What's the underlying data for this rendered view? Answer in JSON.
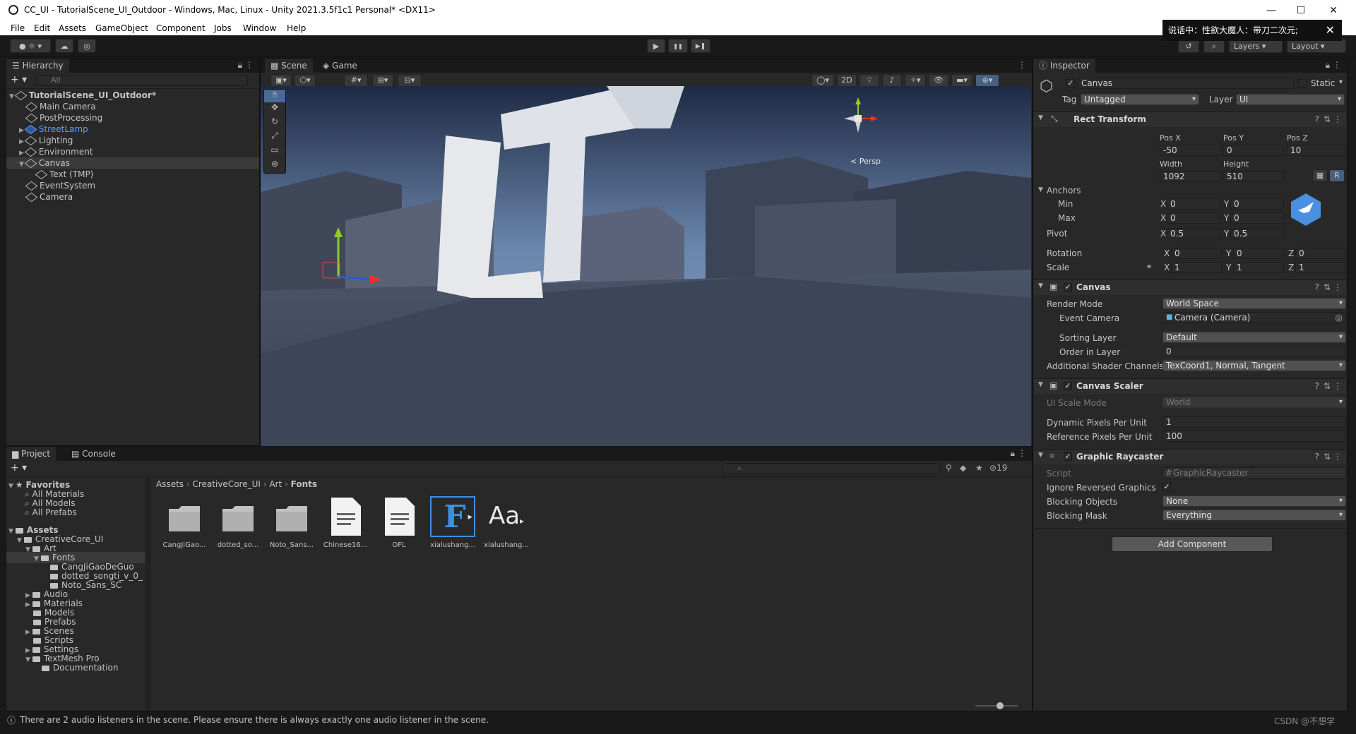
{
  "window": {
    "title": "CC_UI - TutorialScene_UI_Outdoor - Windows, Mac, Linux - Unity 2021.3.5f1c1 Personal* <DX11>",
    "minimize": "—",
    "maximize": "☐",
    "close": "✕"
  },
  "menu": [
    "File",
    "Edit",
    "Assets",
    "GameObject",
    "Component",
    "Jobs",
    "Window",
    "Help"
  ],
  "toolbar": {
    "play": "▶",
    "pause": "❚❚",
    "step": "▶❚",
    "layers": "Layers",
    "layout": "Layout",
    "notification": "说话中：性欲大魔人：带刀二次元;"
  },
  "hierarchy": {
    "tab": "Hierarchy",
    "search_placeholder": "All",
    "items": [
      {
        "label": "TutorialScene_UI_Outdoor*",
        "depth": 0
      },
      {
        "label": "Main Camera",
        "depth": 1
      },
      {
        "label": "PostProcessing",
        "depth": 1
      },
      {
        "label": "StreetLamp",
        "depth": 1
      },
      {
        "label": "Lighting",
        "depth": 1
      },
      {
        "label": "Environment",
        "depth": 1
      },
      {
        "label": "Canvas",
        "depth": 1
      },
      {
        "label": "Text (TMP)",
        "depth": 2
      },
      {
        "label": "EventSystem",
        "depth": 1
      },
      {
        "label": "Camera",
        "depth": 1
      }
    ]
  },
  "scene": {
    "tabs": [
      "Scene",
      "Game"
    ],
    "mode_2d": "2D",
    "persp": "< Persp"
  },
  "project": {
    "tabs": [
      "Project",
      "Console"
    ],
    "favorites_label": "Favorites",
    "favorites": [
      "All Materials",
      "All Models",
      "All Prefabs"
    ],
    "assets_label": "Assets",
    "tree": [
      {
        "label": "CreativeCore_UI",
        "depth": 1
      },
      {
        "label": "Art",
        "depth": 2
      },
      {
        "label": "Fonts",
        "depth": 3
      },
      {
        "label": "CangJiGaoDeGuo",
        "depth": 4
      },
      {
        "label": "dotted_songti_v_0_",
        "depth": 4
      },
      {
        "label": "Noto_Sans_SC",
        "depth": 4
      },
      {
        "label": "Audio",
        "depth": 2
      },
      {
        "label": "Materials",
        "depth": 2
      },
      {
        "label": "Models",
        "depth": 2
      },
      {
        "label": "Prefabs",
        "depth": 2
      },
      {
        "label": "Scenes",
        "depth": 2
      },
      {
        "label": "Scripts",
        "depth": 2
      },
      {
        "label": "Settings",
        "depth": 2
      },
      {
        "label": "TextMesh Pro",
        "depth": 2
      },
      {
        "label": "Documentation",
        "depth": 3
      }
    ],
    "breadcrumb": [
      "Assets",
      "CreativeCore_UI",
      "Art",
      "Fonts"
    ],
    "hidden_count": "19",
    "assets": [
      {
        "label": "CangJiGao...",
        "kind": "folder"
      },
      {
        "label": "dotted_so...",
        "kind": "folder"
      },
      {
        "label": "Noto_Sans...",
        "kind": "folder"
      },
      {
        "label": "Chinese16...",
        "kind": "doc"
      },
      {
        "label": "OFL",
        "kind": "doc"
      },
      {
        "label": "xialushang...",
        "kind": "font-asset"
      },
      {
        "label": "xialushang...",
        "kind": "font"
      }
    ]
  },
  "inspector": {
    "tab": "Inspector",
    "object_name": "Canvas",
    "static_label": "Static",
    "tag_label": "Tag",
    "tag_value": "Untagged",
    "layer_label": "Layer",
    "layer_value": "UI",
    "rect": {
      "title": "Rect Transform",
      "posx_label": "Pos X",
      "posy_label": "Pos Y",
      "posz_label": "Pos Z",
      "posx": "-50",
      "posy": "0",
      "posz": "10",
      "width_label": "Width",
      "height_label": "Height",
      "width": "1092",
      "height": "510",
      "r_button": "R",
      "anchors_label": "Anchors",
      "min_label": "Min",
      "max_label": "Max",
      "min_x": "0",
      "min_y": "0",
      "max_x": "0",
      "max_y": "0",
      "pivot_label": "Pivot",
      "pivot_x": "0.5",
      "pivot_y": "0.5",
      "rotation_label": "Rotation",
      "rot_x": "0",
      "rot_y": "0",
      "rot_z": "0",
      "scale_label": "Scale",
      "scale_x": "1",
      "scale_y": "1",
      "scale_z": "1",
      "x": "X",
      "y": "Y",
      "z": "Z"
    },
    "canvas": {
      "title": "Canvas",
      "render_mode_label": "Render Mode",
      "render_mode": "World Space",
      "event_camera_label": "Event Camera",
      "event_camera": "Camera (Camera)",
      "sorting_layer_label": "Sorting Layer",
      "sorting_layer": "Default",
      "order_label": "Order in Layer",
      "order": "0",
      "shader_channels_label": "Additional Shader Channels",
      "shader_channels": "TexCoord1, Normal, Tangent"
    },
    "scaler": {
      "title": "Canvas Scaler",
      "ui_scale_mode_label": "UI Scale Mode",
      "ui_scale_mode": "World",
      "dynamic_ppu_label": "Dynamic Pixels Per Unit",
      "dynamic_ppu": "1",
      "reference_ppu_label": "Reference Pixels Per Unit",
      "reference_ppu": "100"
    },
    "raycaster": {
      "title": "Graphic Raycaster",
      "script_label": "Script",
      "script": "GraphicRaycaster",
      "ignore_reversed_label": "Ignore Reversed Graphics",
      "ignore_reversed": "✓",
      "blocking_objects_label": "Blocking Objects",
      "blocking_objects": "None",
      "blocking_mask_label": "Blocking Mask",
      "blocking_mask": "Everything"
    },
    "add_component": "Add Component"
  },
  "status": {
    "message": "There are 2 audio listeners in the scene. Please ensure there is always exactly one audio listener in the scene.",
    "watermark": "CSDN @不想学"
  }
}
